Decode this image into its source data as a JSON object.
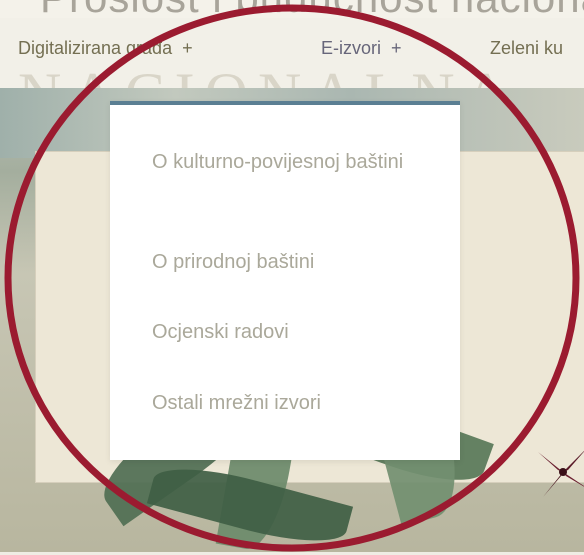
{
  "header": {
    "banner_title": "Prošlost i budućnost nacionalne"
  },
  "watermark": {
    "text": "NACIONALNA"
  },
  "nav": {
    "items": [
      {
        "label": "Digitalizirana građa",
        "expand": "+"
      },
      {
        "label": "E-izvori",
        "expand": "+"
      },
      {
        "label": "Zeleni ku"
      }
    ]
  },
  "dropdown": {
    "items": [
      {
        "label": "O kulturno-povijesnoj baštini"
      },
      {
        "label": "O prirodnoj baštini"
      },
      {
        "label": "Ocjenski radovi"
      },
      {
        "label": "Ostali mrežni izvori"
      }
    ]
  },
  "colors": {
    "nav_text": "#746f52",
    "dropdown_text": "#aaa89a",
    "dropdown_accent": "#5b7f93",
    "annotation_circle": "#9b1b30"
  }
}
